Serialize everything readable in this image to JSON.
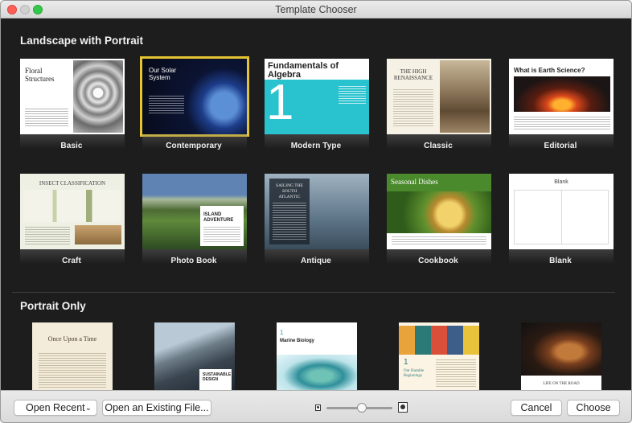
{
  "window": {
    "title": "Template Chooser"
  },
  "sections": {
    "landscape": "Landscape with Portrait",
    "portrait": "Portrait Only"
  },
  "templates": {
    "basic": {
      "label": "Basic",
      "page_title": "Floral Structures"
    },
    "contemporary": {
      "label": "Contemporary",
      "page_title": "Our Solar System"
    },
    "modern_type": {
      "label": "Modern Type",
      "page_title": "Fundamentals of Algebra",
      "page_number": "1"
    },
    "classic": {
      "label": "Classic",
      "page_title": "THE HIGH RENAISSANCE"
    },
    "editorial": {
      "label": "Editorial",
      "page_title": "What is Earth Science?"
    },
    "craft": {
      "label": "Craft",
      "page_title": "INSECT CLASSIFICATION"
    },
    "photo_book": {
      "label": "Photo Book",
      "page_title": "ISLAND ADVENTURE"
    },
    "antique": {
      "label": "Antique",
      "page_title": "SAILING THE SOUTH ATLANTIC"
    },
    "cookbook": {
      "label": "Cookbook",
      "page_title": "Seasonal Dishes"
    },
    "blank": {
      "label": "Blank",
      "page_title": "Blank"
    }
  },
  "portrait_templates": {
    "p1": {
      "page_title": "Once Upon a Time"
    },
    "p2": {
      "page_title": "SUSTAINABLE DESIGN"
    },
    "p3": {
      "page_title": "Marine Biology",
      "page_number": "1"
    },
    "p4": {
      "page_title": "Our Humble Beginnings",
      "page_number": "1"
    },
    "p5": {
      "page_title": "LIFE ON THE ROAD"
    }
  },
  "footer": {
    "open_recent": "Open Recent",
    "open_existing": "Open an Existing File...",
    "cancel": "Cancel",
    "choose": "Choose"
  },
  "colors": {
    "selection": "#e5c432",
    "background": "#1d1d1d",
    "modern_type_accent": "#29c3cf",
    "cookbook_accent": "#4a8a2c"
  }
}
